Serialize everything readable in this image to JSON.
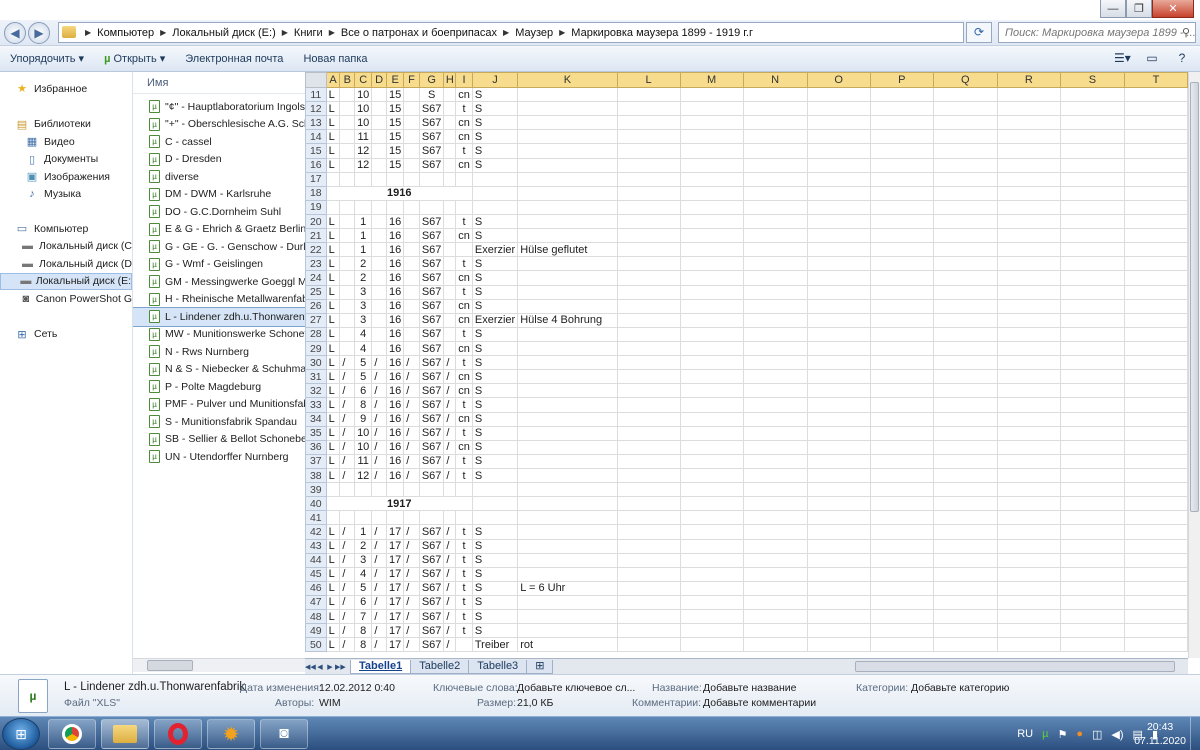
{
  "window": {
    "minimize": "—",
    "maximize": "❐",
    "close": "✕"
  },
  "address": {
    "breadcrumbs": [
      "Компьютер",
      "Локальный диск (E:)",
      "Книги",
      "Все о патронах и боеприпасах",
      "Маузер",
      "Маркировка маузера 1899 - 1919 г.г"
    ],
    "search_placeholder": "Поиск: Маркировка маузера 1899 - ..."
  },
  "toolbar": {
    "organize": "Упорядочить",
    "open": "Открыть",
    "email": "Электронная почта",
    "new_folder": "Новая папка"
  },
  "nav": {
    "favorites": "Избранное",
    "libraries": "Библиотеки",
    "lib_items": [
      "Видео",
      "Документы",
      "Изображения",
      "Музыка"
    ],
    "computer": "Компьютер",
    "drives": [
      "Локальный диск (C",
      "Локальный диск (D",
      "Локальный диск (E:",
      "Canon PowerShot G"
    ],
    "network": "Сеть"
  },
  "files": {
    "column": "Имя",
    "items": [
      "\"¢\" - Hauptlaboratorium Ingols",
      "\"+\" - Oberschlesische A.G. Sch",
      "C - cassel",
      "D - Dresden",
      "diverse",
      "DM - DWM - Karlsruhe",
      "DO - G.C.Dornheim Suhl",
      "E & G - Ehrich & Graetz Berlin",
      "G - GE - G. - Genschow - Durlac",
      "G - Wmf - Geislingen",
      "GM - Messingwerke Goeggl Mc",
      "H - Rheinische Metallwarenfabr",
      "L - Lindener zdh.u.Thonwarenfa",
      "MW - Munitionswerke Schonet",
      "N - Rws Nurnberg",
      "N & S - Niebecker & Schuhmac",
      "P - Polte Magdeburg",
      "PMF - Pulver und Munitionsfab",
      "S - Munitionsfabrik Spandau",
      "SB - Sellier & Bellot Schonebecl",
      "UN - Utendorffer Nurnberg"
    ]
  },
  "sheet": {
    "columns": [
      "A",
      "B",
      "C",
      "D",
      "E",
      "F",
      "G",
      "H",
      "I",
      "J",
      "K",
      "L",
      "M",
      "N",
      "O",
      "P",
      "Q",
      "R",
      "S",
      "T"
    ],
    "rows": [
      {
        "n": "11",
        "c": [
          "L",
          "",
          "10",
          "",
          "15",
          "",
          "S",
          "",
          "cn",
          "S",
          "",
          "",
          "",
          "",
          "",
          "",
          "",
          "",
          "",
          ""
        ]
      },
      {
        "n": "12",
        "c": [
          "L",
          "",
          "10",
          "",
          "15",
          "",
          "S67",
          "",
          "t",
          "S",
          "",
          "",
          "",
          "",
          "",
          "",
          "",
          "",
          "",
          ""
        ]
      },
      {
        "n": "13",
        "c": [
          "L",
          "",
          "10",
          "",
          "15",
          "",
          "S67",
          "",
          "cn",
          "S",
          "",
          "",
          "",
          "",
          "",
          "",
          "",
          "",
          "",
          ""
        ]
      },
      {
        "n": "14",
        "c": [
          "L",
          "",
          "11",
          "",
          "15",
          "",
          "S67",
          "",
          "cn",
          "S",
          "",
          "",
          "",
          "",
          "",
          "",
          "",
          "",
          "",
          ""
        ]
      },
      {
        "n": "15",
        "c": [
          "L",
          "",
          "12",
          "",
          "15",
          "",
          "S67",
          "",
          "t",
          "S",
          "",
          "",
          "",
          "",
          "",
          "",
          "",
          "",
          "",
          ""
        ]
      },
      {
        "n": "16",
        "c": [
          "L",
          "",
          "12",
          "",
          "15",
          "",
          "S67",
          "",
          "cn",
          "S",
          "",
          "",
          "",
          "",
          "",
          "",
          "",
          "",
          "",
          ""
        ]
      },
      {
        "n": "17",
        "c": [
          "",
          "",
          "",
          "",
          "",
          "",
          "",
          "",
          "",
          "",
          "",
          "",
          "",
          "",
          "",
          "",
          "",
          "",
          "",
          ""
        ]
      },
      {
        "n": "18",
        "year": "1916"
      },
      {
        "n": "19",
        "c": [
          "",
          "",
          "",
          "",
          "",
          "",
          "",
          "",
          "",
          "",
          "",
          "",
          "",
          "",
          "",
          "",
          "",
          "",
          "",
          ""
        ]
      },
      {
        "n": "20",
        "c": [
          "L",
          "",
          "1",
          "",
          "16",
          "",
          "S67",
          "",
          "t",
          "S",
          "",
          "",
          "",
          "",
          "",
          "",
          "",
          "",
          "",
          ""
        ]
      },
      {
        "n": "21",
        "c": [
          "L",
          "",
          "1",
          "",
          "16",
          "",
          "S67",
          "",
          "cn",
          "S",
          "",
          "",
          "",
          "",
          "",
          "",
          "",
          "",
          "",
          ""
        ]
      },
      {
        "n": "22",
        "c": [
          "L",
          "",
          "1",
          "",
          "16",
          "",
          "S67",
          "",
          "",
          "Exerzier",
          "Hülse geflutet",
          "",
          "",
          "",
          "",
          "",
          "",
          "",
          "",
          ""
        ]
      },
      {
        "n": "23",
        "c": [
          "L",
          "",
          "2",
          "",
          "16",
          "",
          "S67",
          "",
          "t",
          "S",
          "",
          "",
          "",
          "",
          "",
          "",
          "",
          "",
          "",
          ""
        ]
      },
      {
        "n": "24",
        "c": [
          "L",
          "",
          "2",
          "",
          "16",
          "",
          "S67",
          "",
          "cn",
          "S",
          "",
          "",
          "",
          "",
          "",
          "",
          "",
          "",
          "",
          ""
        ]
      },
      {
        "n": "25",
        "c": [
          "L",
          "",
          "3",
          "",
          "16",
          "",
          "S67",
          "",
          "t",
          "S",
          "",
          "",
          "",
          "",
          "",
          "",
          "",
          "",
          "",
          ""
        ]
      },
      {
        "n": "26",
        "c": [
          "L",
          "",
          "3",
          "",
          "16",
          "",
          "S67",
          "",
          "cn",
          "S",
          "",
          "",
          "",
          "",
          "",
          "",
          "",
          "",
          "",
          ""
        ]
      },
      {
        "n": "27",
        "c": [
          "L",
          "",
          "3",
          "",
          "16",
          "",
          "S67",
          "",
          "cn",
          "Exerzier",
          "Hülse 4 Bohrung",
          "",
          "",
          "",
          "",
          "",
          "",
          "",
          "",
          ""
        ]
      },
      {
        "n": "28",
        "c": [
          "L",
          "",
          "4",
          "",
          "16",
          "",
          "S67",
          "",
          "t",
          "S",
          "",
          "",
          "",
          "",
          "",
          "",
          "",
          "",
          "",
          ""
        ]
      },
      {
        "n": "29",
        "c": [
          "L",
          "",
          "4",
          "",
          "16",
          "",
          "S67",
          "",
          "cn",
          "S",
          "",
          "",
          "",
          "",
          "",
          "",
          "",
          "",
          "",
          ""
        ]
      },
      {
        "n": "30",
        "c": [
          "L",
          "/",
          "5",
          "/",
          "16",
          "/",
          "S67",
          "/",
          "t",
          "S",
          "",
          "",
          "",
          "",
          "",
          "",
          "",
          "",
          "",
          ""
        ]
      },
      {
        "n": "31",
        "c": [
          "L",
          "/",
          "5",
          "/",
          "16",
          "/",
          "S67",
          "/",
          "cn",
          "S",
          "",
          "",
          "",
          "",
          "",
          "",
          "",
          "",
          "",
          ""
        ]
      },
      {
        "n": "32",
        "c": [
          "L",
          "/",
          "6",
          "/",
          "16",
          "/",
          "S67",
          "/",
          "cn",
          "S",
          "",
          "",
          "",
          "",
          "",
          "",
          "",
          "",
          "",
          ""
        ]
      },
      {
        "n": "33",
        "c": [
          "L",
          "/",
          "8",
          "/",
          "16",
          "/",
          "S67",
          "/",
          "t",
          "S",
          "",
          "",
          "",
          "",
          "",
          "",
          "",
          "",
          "",
          ""
        ]
      },
      {
        "n": "34",
        "c": [
          "L",
          "/",
          "9",
          "/",
          "16",
          "/",
          "S67",
          "/",
          "cn",
          "S",
          "",
          "",
          "",
          "",
          "",
          "",
          "",
          "",
          "",
          ""
        ]
      },
      {
        "n": "35",
        "c": [
          "L",
          "/",
          "10",
          "/",
          "16",
          "/",
          "S67",
          "/",
          "t",
          "S",
          "",
          "",
          "",
          "",
          "",
          "",
          "",
          "",
          "",
          ""
        ]
      },
      {
        "n": "36",
        "c": [
          "L",
          "/",
          "10",
          "/",
          "16",
          "/",
          "S67",
          "/",
          "cn",
          "S",
          "",
          "",
          "",
          "",
          "",
          "",
          "",
          "",
          "",
          ""
        ]
      },
      {
        "n": "37",
        "c": [
          "L",
          "/",
          "11",
          "/",
          "16",
          "/",
          "S67",
          "/",
          "t",
          "S",
          "",
          "",
          "",
          "",
          "",
          "",
          "",
          "",
          "",
          ""
        ]
      },
      {
        "n": "38",
        "c": [
          "L",
          "/",
          "12",
          "/",
          "16",
          "/",
          "S67",
          "/",
          "t",
          "S",
          "",
          "",
          "",
          "",
          "",
          "",
          "",
          "",
          "",
          ""
        ]
      },
      {
        "n": "39",
        "c": [
          "",
          "",
          "",
          "",
          "",
          "",
          "",
          "",
          "",
          "",
          "",
          "",
          "",
          "",
          "",
          "",
          "",
          "",
          "",
          ""
        ]
      },
      {
        "n": "40",
        "year": "1917"
      },
      {
        "n": "41",
        "c": [
          "",
          "",
          "",
          "",
          "",
          "",
          "",
          "",
          "",
          "",
          "",
          "",
          "",
          "",
          "",
          "",
          "",
          "",
          "",
          ""
        ]
      },
      {
        "n": "42",
        "c": [
          "L",
          "/",
          "1",
          "/",
          "17",
          "/",
          "S67",
          "/",
          "t",
          "S",
          "",
          "",
          "",
          "",
          "",
          "",
          "",
          "",
          "",
          ""
        ]
      },
      {
        "n": "43",
        "c": [
          "L",
          "/",
          "2",
          "/",
          "17",
          "/",
          "S67",
          "/",
          "t",
          "S",
          "",
          "",
          "",
          "",
          "",
          "",
          "",
          "",
          "",
          ""
        ]
      },
      {
        "n": "44",
        "c": [
          "L",
          "/",
          "3",
          "/",
          "17",
          "/",
          "S67",
          "/",
          "t",
          "S",
          "",
          "",
          "",
          "",
          "",
          "",
          "",
          "",
          "",
          ""
        ]
      },
      {
        "n": "45",
        "c": [
          "L",
          "/",
          "4",
          "/",
          "17",
          "/",
          "S67",
          "/",
          "t",
          "S",
          "",
          "",
          "",
          "",
          "",
          "",
          "",
          "",
          "",
          ""
        ]
      },
      {
        "n": "46",
        "c": [
          "L",
          "/",
          "5",
          "/",
          "17",
          "/",
          "S67",
          "/",
          "t",
          "S",
          "L = 6 Uhr",
          "",
          "",
          "",
          "",
          "",
          "",
          "",
          "",
          ""
        ]
      },
      {
        "n": "47",
        "c": [
          "L",
          "/",
          "6",
          "/",
          "17",
          "/",
          "S67",
          "/",
          "t",
          "S",
          "",
          "",
          "",
          "",
          "",
          "",
          "",
          "",
          "",
          ""
        ]
      },
      {
        "n": "48",
        "c": [
          "L",
          "/",
          "7",
          "/",
          "17",
          "/",
          "S67",
          "/",
          "t",
          "S",
          "",
          "",
          "",
          "",
          "",
          "",
          "",
          "",
          "",
          ""
        ]
      },
      {
        "n": "49",
        "c": [
          "L",
          "/",
          "8",
          "/",
          "17",
          "/",
          "S67",
          "/",
          "t",
          "S",
          "",
          "",
          "",
          "",
          "",
          "",
          "",
          "",
          "",
          ""
        ]
      },
      {
        "n": "50",
        "c": [
          "L",
          "/",
          "8",
          "/",
          "17",
          "/",
          "S67",
          "/",
          "",
          "Treiber",
          "rot",
          "",
          "",
          "",
          "",
          "",
          "",
          "",
          "",
          ""
        ]
      }
    ],
    "tabs": [
      "Tabelle1",
      "Tabelle2",
      "Tabelle3"
    ]
  },
  "details": {
    "filename": "L - Lindener zdh.u.Thonwarenfabrik",
    "filetype": "Файл \"XLS\"",
    "modified_label": "Дата изменения:",
    "modified_value": "12.02.2012 0:40",
    "authors_label": "Авторы:",
    "authors_value": "WIM",
    "keywords_label": "Ключевые слова:",
    "keywords_value": "Добавьте ключевое сл...",
    "size_label": "Размер:",
    "size_value": "21,0 КБ",
    "title_label": "Название:",
    "title_value": "Добавьте название",
    "comments_label": "Комментарии:",
    "comments_value": "Добавьте комментарии",
    "category_label": "Категории:",
    "category_value": "Добавьте категорию"
  },
  "taskbar": {
    "lang": "RU",
    "time": "20:43",
    "date": "07.11.2020"
  }
}
